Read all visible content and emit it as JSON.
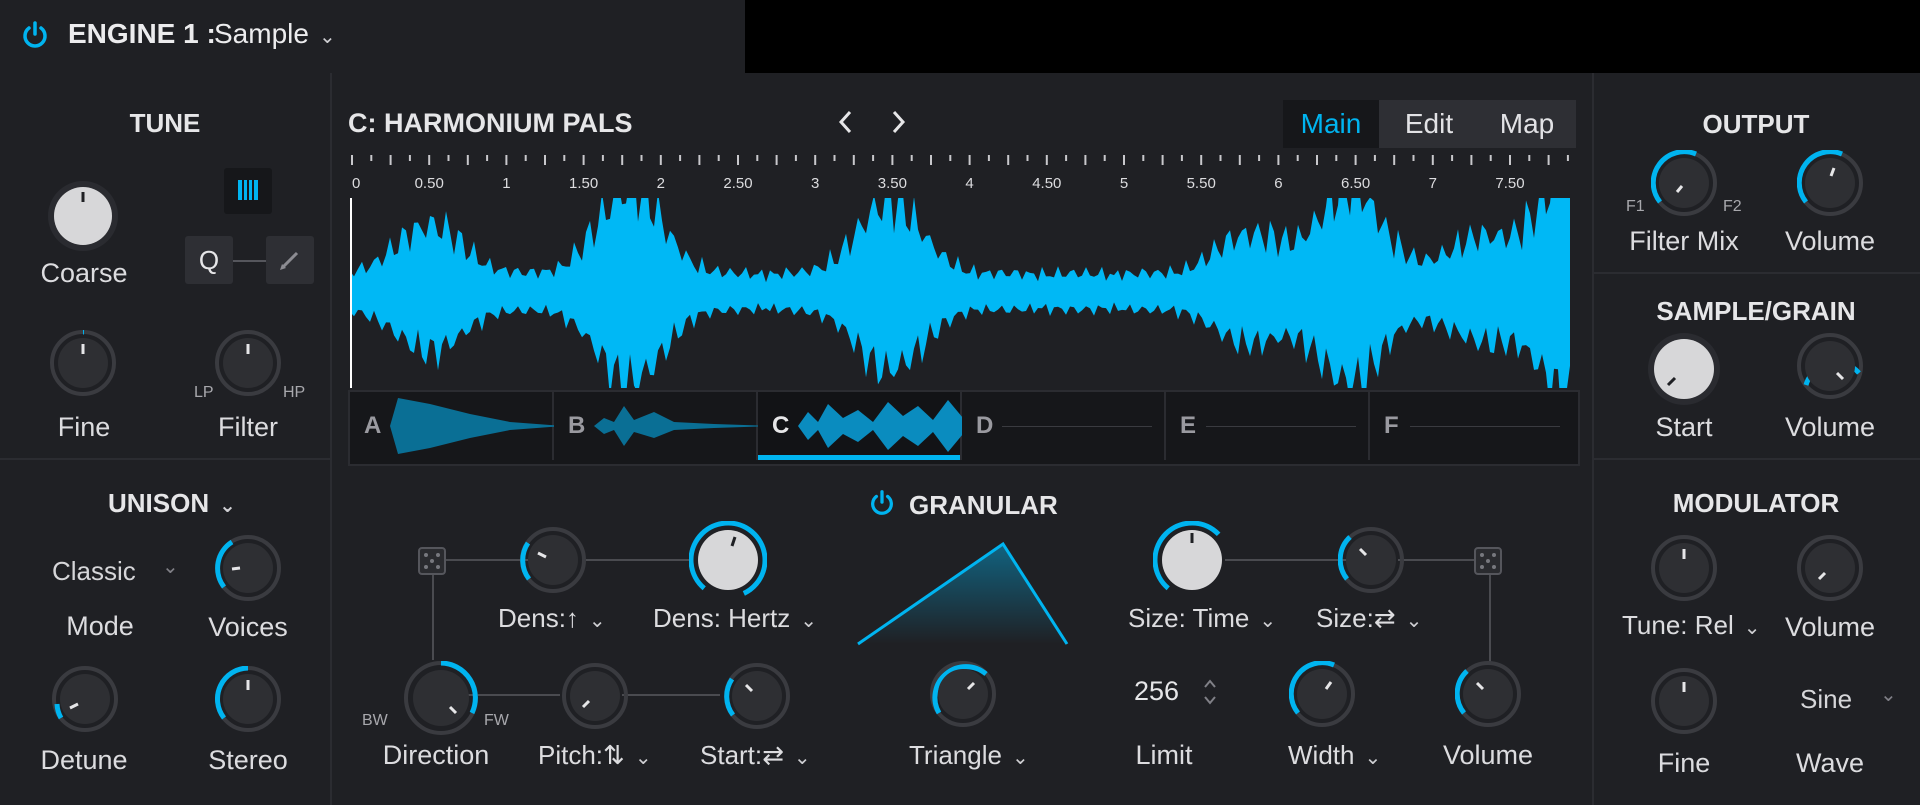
{
  "header": {
    "engine_label": "ENGINE 1 :",
    "engine_type": "Sample"
  },
  "colors": {
    "accent": "#00b4f0",
    "background": "#1f2024",
    "waveform": "#00b8f5",
    "knob_face": "#d7d7d9"
  },
  "tune": {
    "title": "TUNE",
    "coarse": "Coarse",
    "fine": "Fine",
    "filter": "Filter",
    "lp": "LP",
    "hp": "HP",
    "q": "Q",
    "keyboard_icon": "piano-keys-icon",
    "pencil_icon": "pencil-icon"
  },
  "unison": {
    "title": "UNISON",
    "mode_value": "Classic",
    "mode": "Mode",
    "voices": "Voices",
    "detune": "Detune",
    "stereo": "Stereo"
  },
  "sample": {
    "name": "C: HARMONIUM PALS",
    "tabs": [
      "Main",
      "Edit",
      "Map"
    ],
    "active_tab": "Main",
    "ruler": [
      "0",
      "0.50",
      "1",
      "1.50",
      "2",
      "2.50",
      "3",
      "3.50",
      "4",
      "4.50",
      "5",
      "5.50",
      "6",
      "6.50",
      "7",
      "7.50"
    ],
    "slots": [
      "A",
      "B",
      "C",
      "D",
      "E",
      "F"
    ],
    "active_slot": "C"
  },
  "granular": {
    "title": "GRANULAR",
    "dens_mod": "Dens:↑",
    "dens_hertz": "Dens: Hertz",
    "direction": "Direction",
    "bw": "BW",
    "fw": "FW",
    "pitch": "Pitch:⇅",
    "start": "Start:⇄",
    "envelope": "Triangle",
    "size_time": "Size: Time",
    "size_mod": "Size:⇄",
    "limit_value": "256",
    "limit": "Limit",
    "width": "Width",
    "volume": "Volume"
  },
  "output": {
    "title": "OUTPUT",
    "filter_mix": "Filter Mix",
    "f1": "F1",
    "f2": "F2",
    "volume": "Volume"
  },
  "sample_grain": {
    "title": "SAMPLE/GRAIN",
    "start": "Start",
    "volume": "Volume"
  },
  "modulator": {
    "title": "MODULATOR",
    "tune_rel": "Tune: Rel",
    "volume": "Volume",
    "fine": "Fine",
    "wave_value": "Sine",
    "wave": "Wave"
  }
}
